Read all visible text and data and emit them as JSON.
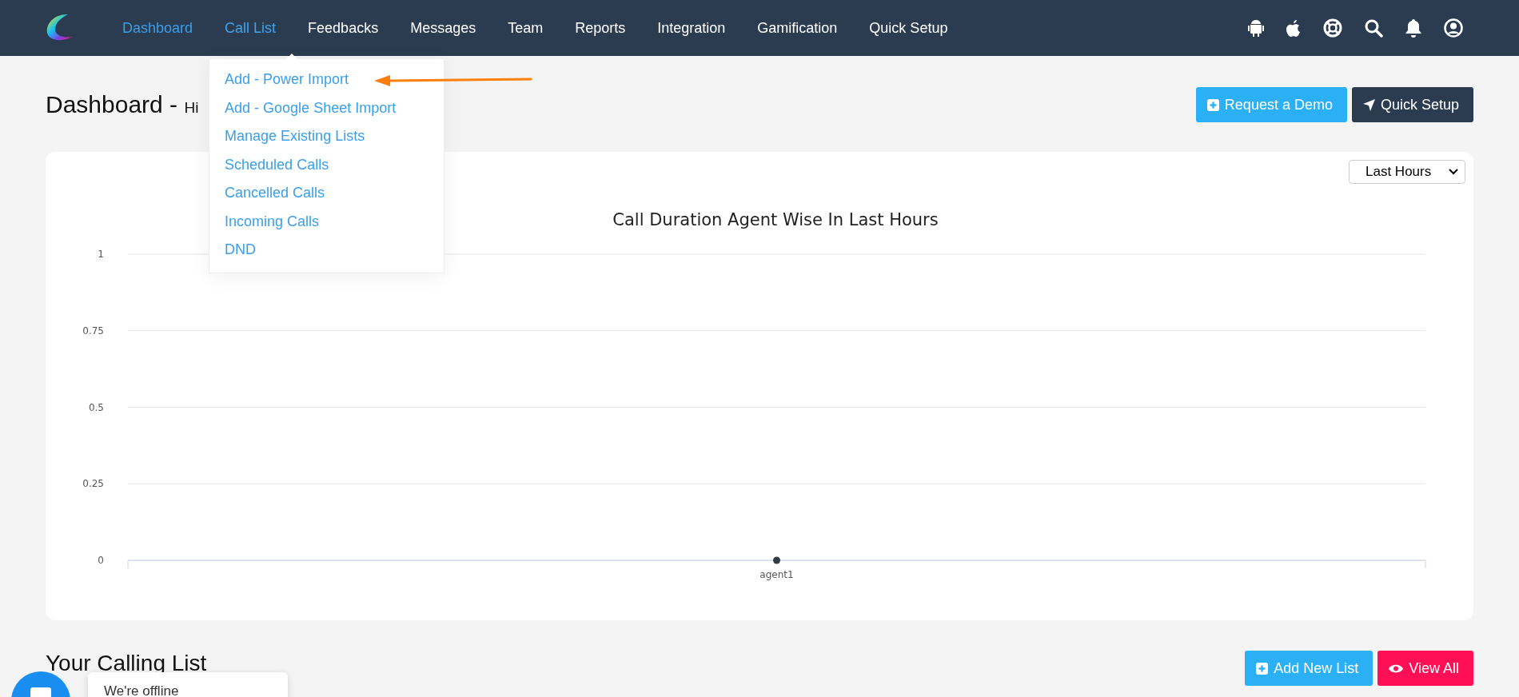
{
  "nav": {
    "items": [
      {
        "label": "Dashboard",
        "selected": true,
        "expanded": false
      },
      {
        "label": "Call List",
        "selected": false,
        "expanded": true,
        "menu": [
          "Add - Power Import",
          "Add - Google Sheet Import",
          "Manage Existing Lists",
          "Scheduled Calls",
          "Cancelled Calls",
          "Incoming Calls",
          "DND"
        ]
      },
      {
        "label": "Feedbacks",
        "selected": false,
        "expanded": false
      },
      {
        "label": "Messages",
        "selected": false,
        "expanded": false
      },
      {
        "label": "Team",
        "selected": false,
        "expanded": false
      },
      {
        "label": "Reports",
        "selected": false,
        "expanded": false
      },
      {
        "label": "Integration",
        "selected": false,
        "expanded": false
      },
      {
        "label": "Gamification",
        "selected": false,
        "expanded": false
      },
      {
        "label": "Quick Setup",
        "selected": false,
        "expanded": false
      }
    ],
    "icons": [
      {
        "kind": "android"
      },
      {
        "kind": "apple"
      },
      {
        "kind": "help"
      },
      {
        "kind": "search"
      },
      {
        "kind": "bell"
      },
      {
        "kind": "user"
      }
    ]
  },
  "header": {
    "title": "Dashboard -",
    "greeting": "Hi",
    "buttons": [
      {
        "label": "Request a Demo",
        "kind": "demo"
      },
      {
        "label": "Quick Setup",
        "kind": "setup"
      }
    ]
  },
  "chart_card": {
    "period": "Last Hours",
    "chart_data": {
      "type": "line",
      "title": "Call Duration Agent Wise In Last Hours",
      "categories": [
        "agent1"
      ],
      "values": [
        0
      ],
      "grid": true,
      "marker": true,
      "ylim": [
        0,
        1
      ],
      "yticks": [
        0,
        0.25,
        0.5,
        0.75,
        1
      ]
    }
  },
  "calling_list": {
    "title": "Your Calling List",
    "buttons": [
      {
        "label": "Add New List",
        "kind": "add"
      },
      {
        "label": "View All",
        "kind": "view"
      }
    ]
  },
  "chat": {
    "status": "We're offline"
  }
}
